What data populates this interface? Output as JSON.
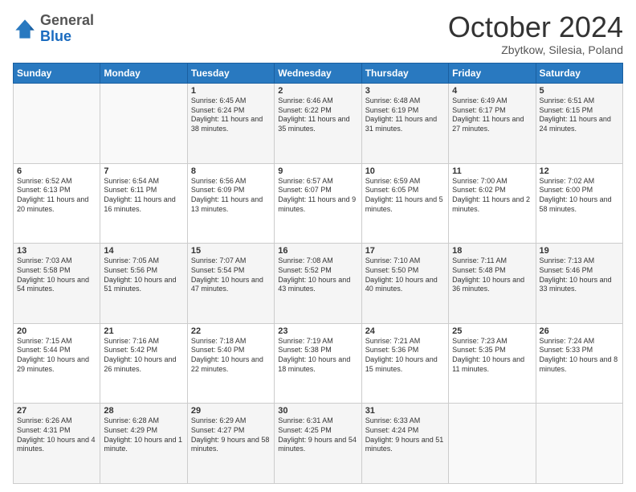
{
  "header": {
    "logo_general": "General",
    "logo_blue": "Blue",
    "month_title": "October 2024",
    "location": "Zbytkow, Silesia, Poland"
  },
  "days_of_week": [
    "Sunday",
    "Monday",
    "Tuesday",
    "Wednesday",
    "Thursday",
    "Friday",
    "Saturday"
  ],
  "weeks": [
    [
      {
        "day": "",
        "info": ""
      },
      {
        "day": "",
        "info": ""
      },
      {
        "day": "1",
        "info": "Sunrise: 6:45 AM\nSunset: 6:24 PM\nDaylight: 11 hours and 38 minutes."
      },
      {
        "day": "2",
        "info": "Sunrise: 6:46 AM\nSunset: 6:22 PM\nDaylight: 11 hours and 35 minutes."
      },
      {
        "day": "3",
        "info": "Sunrise: 6:48 AM\nSunset: 6:19 PM\nDaylight: 11 hours and 31 minutes."
      },
      {
        "day": "4",
        "info": "Sunrise: 6:49 AM\nSunset: 6:17 PM\nDaylight: 11 hours and 27 minutes."
      },
      {
        "day": "5",
        "info": "Sunrise: 6:51 AM\nSunset: 6:15 PM\nDaylight: 11 hours and 24 minutes."
      }
    ],
    [
      {
        "day": "6",
        "info": "Sunrise: 6:52 AM\nSunset: 6:13 PM\nDaylight: 11 hours and 20 minutes."
      },
      {
        "day": "7",
        "info": "Sunrise: 6:54 AM\nSunset: 6:11 PM\nDaylight: 11 hours and 16 minutes."
      },
      {
        "day": "8",
        "info": "Sunrise: 6:56 AM\nSunset: 6:09 PM\nDaylight: 11 hours and 13 minutes."
      },
      {
        "day": "9",
        "info": "Sunrise: 6:57 AM\nSunset: 6:07 PM\nDaylight: 11 hours and 9 minutes."
      },
      {
        "day": "10",
        "info": "Sunrise: 6:59 AM\nSunset: 6:05 PM\nDaylight: 11 hours and 5 minutes."
      },
      {
        "day": "11",
        "info": "Sunrise: 7:00 AM\nSunset: 6:02 PM\nDaylight: 11 hours and 2 minutes."
      },
      {
        "day": "12",
        "info": "Sunrise: 7:02 AM\nSunset: 6:00 PM\nDaylight: 10 hours and 58 minutes."
      }
    ],
    [
      {
        "day": "13",
        "info": "Sunrise: 7:03 AM\nSunset: 5:58 PM\nDaylight: 10 hours and 54 minutes."
      },
      {
        "day": "14",
        "info": "Sunrise: 7:05 AM\nSunset: 5:56 PM\nDaylight: 10 hours and 51 minutes."
      },
      {
        "day": "15",
        "info": "Sunrise: 7:07 AM\nSunset: 5:54 PM\nDaylight: 10 hours and 47 minutes."
      },
      {
        "day": "16",
        "info": "Sunrise: 7:08 AM\nSunset: 5:52 PM\nDaylight: 10 hours and 43 minutes."
      },
      {
        "day": "17",
        "info": "Sunrise: 7:10 AM\nSunset: 5:50 PM\nDaylight: 10 hours and 40 minutes."
      },
      {
        "day": "18",
        "info": "Sunrise: 7:11 AM\nSunset: 5:48 PM\nDaylight: 10 hours and 36 minutes."
      },
      {
        "day": "19",
        "info": "Sunrise: 7:13 AM\nSunset: 5:46 PM\nDaylight: 10 hours and 33 minutes."
      }
    ],
    [
      {
        "day": "20",
        "info": "Sunrise: 7:15 AM\nSunset: 5:44 PM\nDaylight: 10 hours and 29 minutes."
      },
      {
        "day": "21",
        "info": "Sunrise: 7:16 AM\nSunset: 5:42 PM\nDaylight: 10 hours and 26 minutes."
      },
      {
        "day": "22",
        "info": "Sunrise: 7:18 AM\nSunset: 5:40 PM\nDaylight: 10 hours and 22 minutes."
      },
      {
        "day": "23",
        "info": "Sunrise: 7:19 AM\nSunset: 5:38 PM\nDaylight: 10 hours and 18 minutes."
      },
      {
        "day": "24",
        "info": "Sunrise: 7:21 AM\nSunset: 5:36 PM\nDaylight: 10 hours and 15 minutes."
      },
      {
        "day": "25",
        "info": "Sunrise: 7:23 AM\nSunset: 5:35 PM\nDaylight: 10 hours and 11 minutes."
      },
      {
        "day": "26",
        "info": "Sunrise: 7:24 AM\nSunset: 5:33 PM\nDaylight: 10 hours and 8 minutes."
      }
    ],
    [
      {
        "day": "27",
        "info": "Sunrise: 6:26 AM\nSunset: 4:31 PM\nDaylight: 10 hours and 4 minutes."
      },
      {
        "day": "28",
        "info": "Sunrise: 6:28 AM\nSunset: 4:29 PM\nDaylight: 10 hours and 1 minute."
      },
      {
        "day": "29",
        "info": "Sunrise: 6:29 AM\nSunset: 4:27 PM\nDaylight: 9 hours and 58 minutes."
      },
      {
        "day": "30",
        "info": "Sunrise: 6:31 AM\nSunset: 4:25 PM\nDaylight: 9 hours and 54 minutes."
      },
      {
        "day": "31",
        "info": "Sunrise: 6:33 AM\nSunset: 4:24 PM\nDaylight: 9 hours and 51 minutes."
      },
      {
        "day": "",
        "info": ""
      },
      {
        "day": "",
        "info": ""
      }
    ]
  ]
}
